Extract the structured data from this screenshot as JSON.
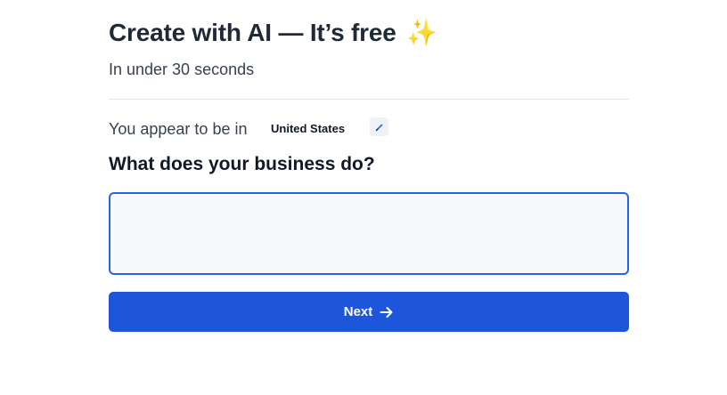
{
  "header": {
    "title": "Create with AI — It’s free",
    "sparkle": "✨",
    "subtitle": "In under 30 seconds"
  },
  "location": {
    "label": "You appear to be in",
    "country": "United States",
    "edit_icon": "pencil-icon"
  },
  "form": {
    "question": "What does your business do?",
    "description_value": "",
    "next_label": "Next",
    "next_icon": "arrow-right-icon"
  },
  "colors": {
    "accent": "#1d56db",
    "focus_border": "#2563eb",
    "input_background": "#f7f9fc"
  }
}
